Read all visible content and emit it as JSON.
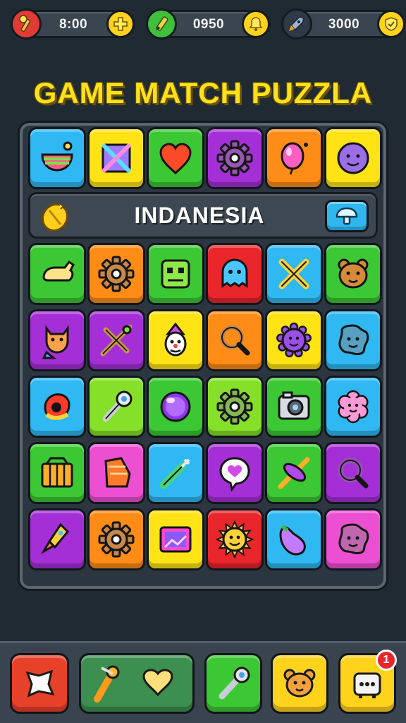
{
  "hud": {
    "stats": [
      {
        "value": "8:00",
        "lead_icon": "matchstick-icon",
        "tail_icon": "plus-icon",
        "lead_color": "#e23a34"
      },
      {
        "value": "0950",
        "lead_icon": "pencil-icon",
        "tail_icon": "bell-icon",
        "lead_color": "#3fbf3a"
      },
      {
        "value": "3000",
        "lead_icon": "rocket-icon",
        "tail_icon": "shield-icon",
        "lead_color": "#2f3a46"
      }
    ]
  },
  "title": "GAME MATCH PUZZLA",
  "banner": {
    "word": "INDANESIA",
    "left_icon": "gold-coin-icon",
    "right_icon": "mushroom-icon"
  },
  "colors": {
    "cyan": "#2fb8f2",
    "yellow": "#ffe315",
    "green": "#3cc734",
    "purple": "#a52fd6",
    "orange": "#ff8c16",
    "red": "#e8262c",
    "lime": "#86e02a",
    "pink": "#ec4fd1"
  },
  "board": {
    "top_row": [
      {
        "icon": "bowl-icon",
        "color": "cyan"
      },
      {
        "icon": "gem-square-icon",
        "color": "yellow"
      },
      {
        "icon": "heart-icon",
        "color": "green"
      },
      {
        "icon": "gear-icon",
        "color": "purple"
      },
      {
        "icon": "balloon-icon",
        "color": "orange"
      },
      {
        "icon": "smiley-icon",
        "color": "yellow"
      }
    ],
    "rows": [
      [
        {
          "icon": "glove-icon",
          "color": "green"
        },
        {
          "icon": "gear-icon",
          "color": "orange"
        },
        {
          "icon": "robot-face-icon",
          "color": "green"
        },
        {
          "icon": "ghost-icon",
          "color": "red"
        },
        {
          "icon": "crossed-tools-icon",
          "color": "cyan"
        },
        {
          "icon": "bear-face-icon",
          "color": "green"
        }
      ],
      [
        {
          "icon": "cat-icon",
          "color": "purple"
        },
        {
          "icon": "crossbow-icon",
          "color": "purple"
        },
        {
          "icon": "clown-icon",
          "color": "yellow"
        },
        {
          "icon": "magnifier-icon",
          "color": "orange"
        },
        {
          "icon": "virus-icon",
          "color": "yellow"
        },
        {
          "icon": "blob-face-icon",
          "color": "cyan"
        }
      ],
      [
        {
          "icon": "donut-icon",
          "color": "cyan"
        },
        {
          "icon": "wrench-icon",
          "color": "lime"
        },
        {
          "icon": "orb-icon",
          "color": "green"
        },
        {
          "icon": "gear-icon",
          "color": "lime"
        },
        {
          "icon": "camera-icon",
          "color": "green"
        },
        {
          "icon": "flower-face-icon",
          "color": "cyan"
        }
      ],
      [
        {
          "icon": "crate-icon",
          "color": "green"
        },
        {
          "icon": "boot-icon",
          "color": "pink"
        },
        {
          "icon": "syringe-icon",
          "color": "cyan"
        },
        {
          "icon": "chat-heart-icon",
          "color": "purple"
        },
        {
          "icon": "candy-cross-icon",
          "color": "green"
        },
        {
          "icon": "magnifier-icon",
          "color": "purple"
        }
      ],
      [
        {
          "icon": "rocket-icon",
          "color": "purple"
        },
        {
          "icon": "gear-icon",
          "color": "orange"
        },
        {
          "icon": "picture-frame-icon",
          "color": "yellow"
        },
        {
          "icon": "sun-face-icon",
          "color": "red"
        },
        {
          "icon": "eggplant-icon",
          "color": "cyan"
        },
        {
          "icon": "blob-face-icon",
          "color": "pink"
        }
      ]
    ]
  },
  "tray": {
    "buttons": [
      {
        "icon": "paper-icon",
        "color": "#e8412a"
      },
      {
        "icon": "tools-and-heart-icon",
        "color": "#3c8f4e"
      },
      {
        "icon": "wrench-icon",
        "color": "#3cc734"
      },
      {
        "icon": "bear-face-icon",
        "color": "#ffd21c"
      },
      {
        "icon": "radio-icon",
        "color": "#ffd21c",
        "badge": "1"
      }
    ]
  }
}
